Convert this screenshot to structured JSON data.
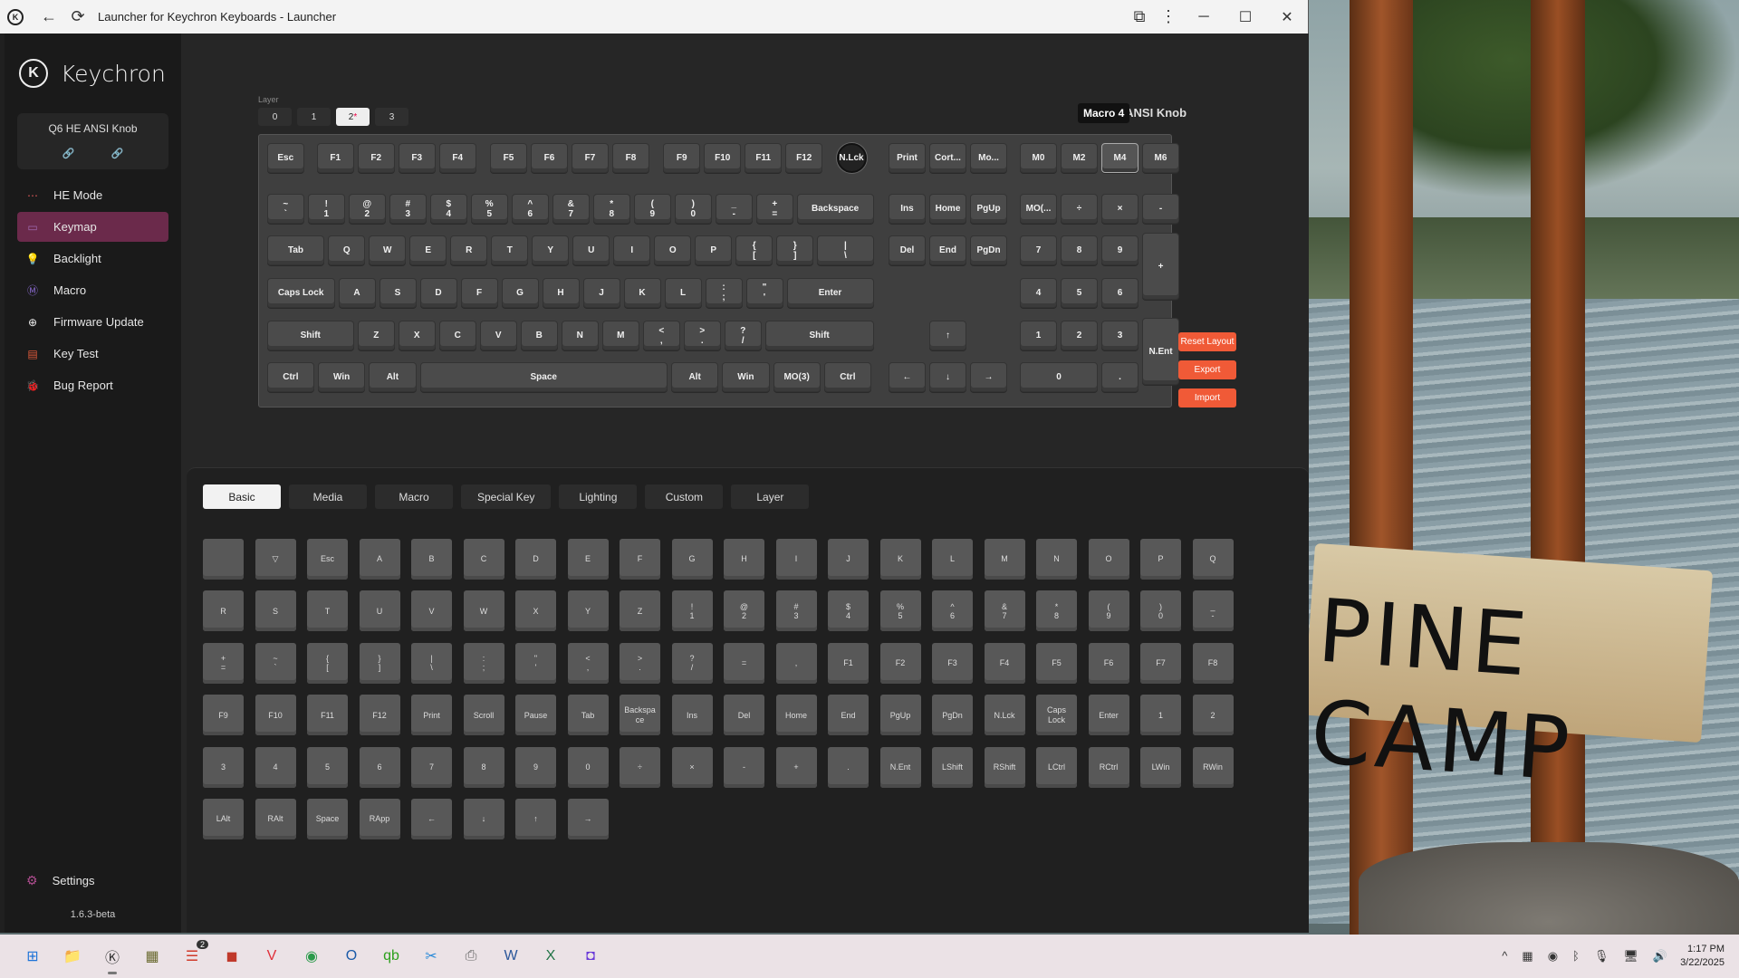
{
  "window": {
    "title": "Launcher for Keychron Keyboards - Launcher",
    "icons": [
      "back-arrow-icon",
      "reload-icon",
      "extension-icon",
      "more-vert-icon"
    ],
    "controls": {
      "minimize": "─",
      "maximize": "☐",
      "close": "✕"
    }
  },
  "sidebar": {
    "brand": "Keychron",
    "device": {
      "name": "Q6 HE ANSI Knob",
      "link1": "🔗",
      "link2": "🔗"
    },
    "items": [
      {
        "label": "HE Mode",
        "icon": "he-mode-icon",
        "glyph": "⋯",
        "color": "#e05a5a"
      },
      {
        "label": "Keymap",
        "icon": "keymap-icon",
        "glyph": "▭",
        "color": "#a06ab0"
      },
      {
        "label": "Backlight",
        "icon": "bulb-icon",
        "glyph": "💡",
        "color": "#3fb66a"
      },
      {
        "label": "Macro",
        "icon": "macro-icon",
        "glyph": "Ⓜ",
        "color": "#8a6ad0"
      },
      {
        "label": "Firmware Update",
        "icon": "update-icon",
        "glyph": "⊕",
        "color": "#f0f0f0"
      },
      {
        "label": "Key Test",
        "icon": "key-test-icon",
        "glyph": "▤",
        "color": "#e05a3a"
      },
      {
        "label": "Bug Report",
        "icon": "bug-icon",
        "glyph": "🐞",
        "color": "#d04a80"
      }
    ],
    "active_index": 1,
    "settings": "Settings",
    "version": "1.6.3-beta"
  },
  "keymap": {
    "layer_label": "Layer",
    "layers": [
      "0",
      "1",
      "2",
      "3"
    ],
    "active_layer": "2",
    "device_title": "Q6 HE ANSI Knob",
    "tooltip": "Macro 4",
    "buttons": {
      "reset": "Reset Layout",
      "export": "Export",
      "import": "Import"
    },
    "rows": [
      [
        "Esc",
        "F1",
        "F2",
        "F3",
        "F4",
        "F5",
        "F6",
        "F7",
        "F8",
        "F9",
        "F10",
        "F11",
        "F12",
        "N.Lck",
        "Print",
        "Cort...",
        "Mo...",
        "M0",
        "M2",
        "M4",
        "M6"
      ],
      [
        "~\n`",
        "!\n1",
        "@\n2",
        "#\n3",
        "$\n4",
        "%\n5",
        "^\n6",
        "&\n7",
        "*\n8",
        "(\n9",
        ")\n0",
        "_\n-",
        "+\n=",
        "Backspace",
        "Ins",
        "Home",
        "PgUp",
        "MO(...",
        "÷",
        "×",
        "-"
      ],
      [
        "Tab",
        "Q",
        "W",
        "E",
        "R",
        "T",
        "Y",
        "U",
        "I",
        "O",
        "P",
        "{\n[",
        "}\n]",
        "|\n\\",
        "Del",
        "End",
        "PgDn",
        "7",
        "8",
        "9",
        "+"
      ],
      [
        "Caps Lock",
        "A",
        "S",
        "D",
        "F",
        "G",
        "H",
        "J",
        "K",
        "L",
        ":\n;",
        "\"\n'",
        "Enter",
        "4",
        "5",
        "6"
      ],
      [
        "Shift",
        "Z",
        "X",
        "C",
        "V",
        "B",
        "N",
        "M",
        "<\n,",
        ">\n.",
        "?\n/",
        "Shift",
        "↑",
        "1",
        "2",
        "3",
        "N.Ent"
      ],
      [
        "Ctrl",
        "Win",
        "Alt",
        "Space",
        "Alt",
        "Win",
        "MO(3)",
        "Ctrl",
        "←",
        "↓",
        "→",
        "0",
        "."
      ]
    ]
  },
  "panel": {
    "tabs": [
      "Basic",
      "Media",
      "Macro",
      "Special Key",
      "Lighting",
      "Custom",
      "Layer"
    ],
    "active_tab": "Basic",
    "keys": [
      "",
      "▽",
      "Esc",
      "A",
      "B",
      "C",
      "D",
      "E",
      "F",
      "G",
      "H",
      "I",
      "J",
      "K",
      "L",
      "M",
      "N",
      "O",
      "P",
      "Q",
      "R",
      "S",
      "T",
      "U",
      "V",
      "W",
      "X",
      "Y",
      "Z",
      "!\n1",
      "@\n2",
      "#\n3",
      "$\n4",
      "%\n5",
      "^\n6",
      "&\n7",
      "*\n8",
      "(\n9",
      ")\n0",
      "_\n-",
      "+\n=",
      "~\n`",
      "{\n[",
      "}\n]",
      "|\n\\",
      ":\n;",
      "\"\n'",
      "<\n,",
      ">\n.",
      "?\n/",
      "=",
      ",",
      "F1",
      "F2",
      "F3",
      "F4",
      "F5",
      "F6",
      "F7",
      "F8",
      "F9",
      "F10",
      "F11",
      "F12",
      "Print",
      "Scroll",
      "Pause",
      "Tab",
      "Backspa\nce",
      "Ins",
      "Del",
      "Home",
      "End",
      "PgUp",
      "PgDn",
      "N.Lck",
      "Caps\nLock",
      "Enter",
      "1",
      "2",
      "3",
      "4",
      "5",
      "6",
      "7",
      "8",
      "9",
      "0",
      "÷",
      "×",
      "-",
      "+",
      ".",
      "N.Ent",
      "LShift",
      "RShift",
      "LCtrl",
      "RCtrl",
      "LWin",
      "RWin",
      "LAlt",
      "RAlt",
      "Space",
      "RApp",
      "←",
      "↓",
      "↑",
      "→"
    ]
  },
  "taskbar": {
    "apps": [
      {
        "name": "start-icon",
        "glyph": "⊞",
        "color": "#1d73d8"
      },
      {
        "name": "file-explorer-icon",
        "glyph": "📁",
        "color": "#e8b030"
      },
      {
        "name": "keychron-launcher-icon",
        "glyph": "Ⓚ",
        "color": "#333"
      },
      {
        "name": "calculator-icon",
        "glyph": "▦",
        "color": "#6a6a30"
      },
      {
        "name": "todoist-icon",
        "glyph": "☰",
        "color": "#d03a2a",
        "badge": "2"
      },
      {
        "name": "app-icon-red",
        "glyph": "◼",
        "color": "#c0392b"
      },
      {
        "name": "vivaldi-icon",
        "glyph": "V",
        "color": "#e0303a"
      },
      {
        "name": "chrome-icon",
        "glyph": "◉",
        "color": "#2a9a4a"
      },
      {
        "name": "outlook-icon",
        "glyph": "O",
        "color": "#1a5aa8"
      },
      {
        "name": "quickbooks-icon",
        "glyph": "qb",
        "color": "#2ca01c"
      },
      {
        "name": "snipping-tool-icon",
        "glyph": "✂",
        "color": "#2a8ad8"
      },
      {
        "name": "printer-icon",
        "glyph": "⎙",
        "color": "#666"
      },
      {
        "name": "word-icon",
        "glyph": "W",
        "color": "#2b579a"
      },
      {
        "name": "excel-icon",
        "glyph": "X",
        "color": "#217346"
      },
      {
        "name": "app-icon-purple",
        "glyph": "◘",
        "color": "#6a3ad8"
      }
    ],
    "tray_icons": [
      "chevron-up-icon",
      "app-tray-icon",
      "color-tray-icon",
      "bluetooth-icon",
      "microphone-icon",
      "network-icon",
      "volume-icon"
    ],
    "tray_glyphs": [
      "^",
      "▦",
      "◉",
      "ᛒ",
      "🎙",
      "🖥",
      "🔊"
    ],
    "time": "1:17 PM",
    "date": "3/22/2025"
  }
}
